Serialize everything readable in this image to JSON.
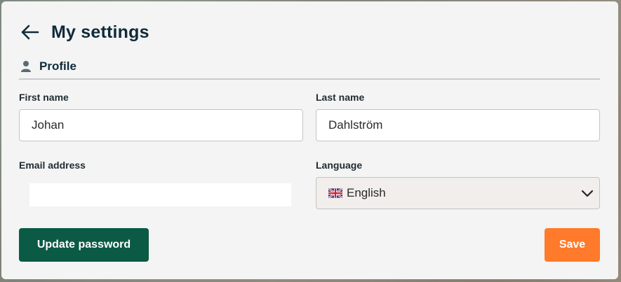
{
  "header": {
    "title": "My settings",
    "back_icon": "arrow-left-icon"
  },
  "profile_section": {
    "label": "Profile",
    "icon": "user-icon"
  },
  "fields": {
    "first_name": {
      "label": "First name",
      "value": "Johan"
    },
    "last_name": {
      "label": "Last name",
      "value": "Dahlström"
    },
    "email": {
      "label": "Email address",
      "value": ""
    },
    "language": {
      "label": "Language",
      "value": "English",
      "flag_icon": "uk-flag-icon"
    }
  },
  "buttons": {
    "update_password": "Update password",
    "save": "Save"
  },
  "colors": {
    "primary": "#0b5a45",
    "accent": "#ff7a2a",
    "heading": "#0f2b3a"
  }
}
